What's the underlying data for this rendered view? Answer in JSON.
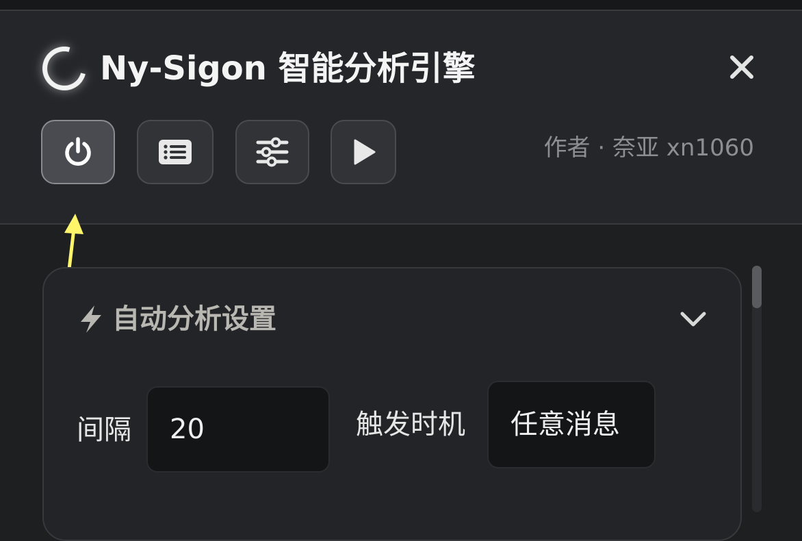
{
  "header": {
    "title": "Ny-Sigon 智能分析引擎",
    "author": "作者 · 奈亚 xn1060",
    "logo_icon": "loading-ring-icon",
    "close_icon": "close-icon"
  },
  "toolbar": {
    "buttons": [
      {
        "icon": "power-icon",
        "active": true
      },
      {
        "icon": "list-icon",
        "active": false
      },
      {
        "icon": "sliders-icon",
        "active": false
      },
      {
        "icon": "play-icon",
        "active": false
      }
    ]
  },
  "annotation": {
    "color": "#fff56a",
    "icon": "arrow-up-icon"
  },
  "section": {
    "icon": "lightning-bolt-icon",
    "title": "自动分析设置",
    "toggle_icon": "chevron-down-icon",
    "interval_label": "间隔",
    "interval_value": "20",
    "trigger_label": "触发时机",
    "trigger_value": "任意消息"
  },
  "colors": {
    "background": "#1e1f21",
    "header_bg": "#25262a",
    "input_bg": "#141517",
    "muted_text": "#8d8e92",
    "section_title": "#b8b7b2"
  }
}
